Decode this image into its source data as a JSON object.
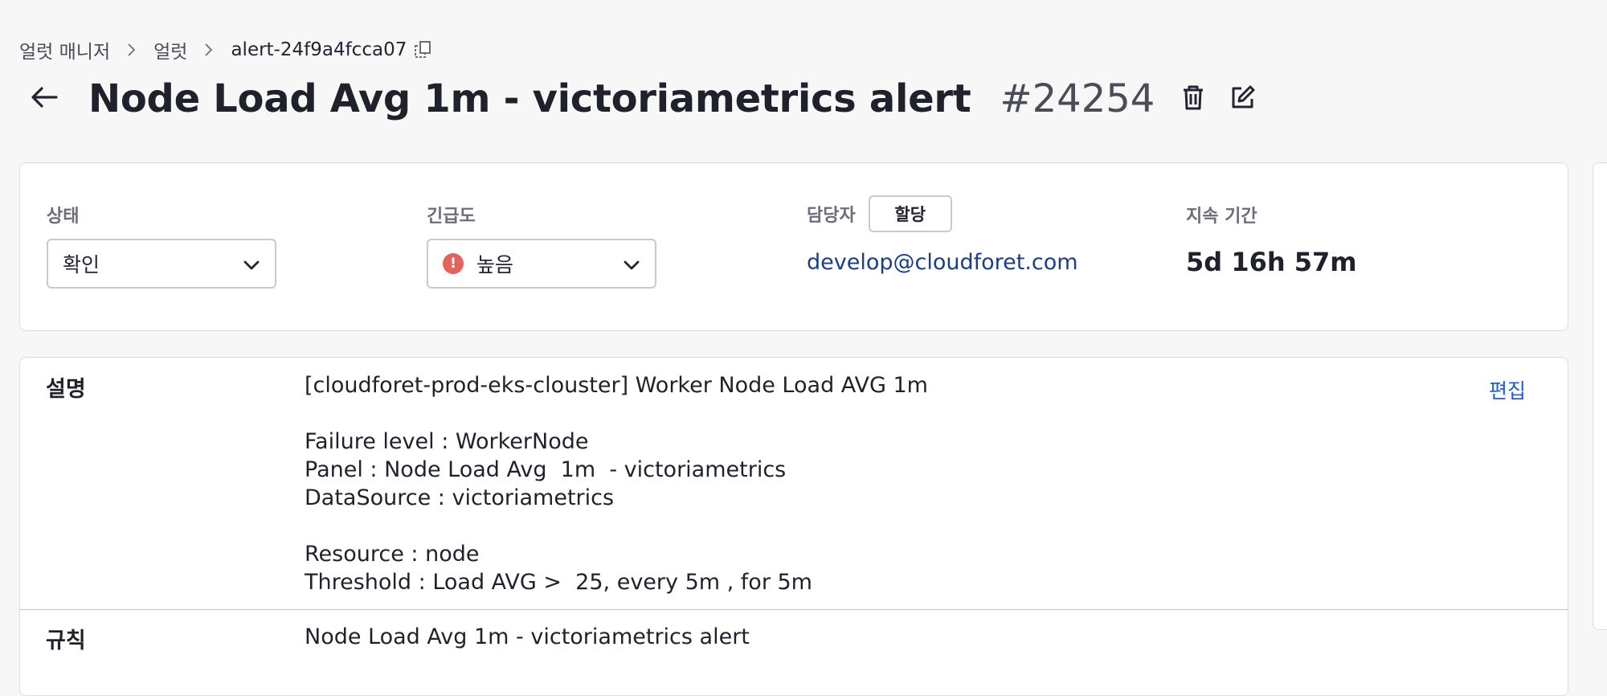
{
  "breadcrumb": {
    "items": [
      "얼럿 매니저",
      "얼럿"
    ],
    "current": "alert-24f9a4fcca07"
  },
  "header": {
    "title": "Node Load Avg 1m - victoriametrics alert",
    "number": "#24254"
  },
  "info": {
    "status": {
      "label": "상태",
      "value": "확인"
    },
    "urgency": {
      "label": "긴급도",
      "value": "높음"
    },
    "assignee": {
      "label": "담당자",
      "assign_button": "할당",
      "email": "develop@cloudforet.com"
    },
    "duration": {
      "label": "지속 기간",
      "value": "5d 16h 57m"
    }
  },
  "details": {
    "description": {
      "label": "설명",
      "edit_label": "편집",
      "text": "[cloudforet-prod-eks-clouster] Worker Node Load AVG 1m\n\nFailure level : WorkerNode\nPanel : Node Load Avg  1m  - victoriametrics\nDataSource : victoriametrics\n\nResource : node\nThreshold : Load AVG >  25, every 5m , for 5m"
    },
    "rule": {
      "label": "규칙",
      "text": "Node Load Avg 1m - victoriametrics alert"
    }
  },
  "colors": {
    "background": "#f7f7f7",
    "link": "#1d5fd1",
    "email": "#1a3e8a",
    "severity_high": "#e2645c"
  },
  "icons": {
    "back": "arrow-left-icon",
    "copy": "copy-icon",
    "delete": "trash-icon",
    "edit": "edit-icon",
    "dropdown": "chevron-down-icon",
    "severity": "alert-circle-icon"
  }
}
